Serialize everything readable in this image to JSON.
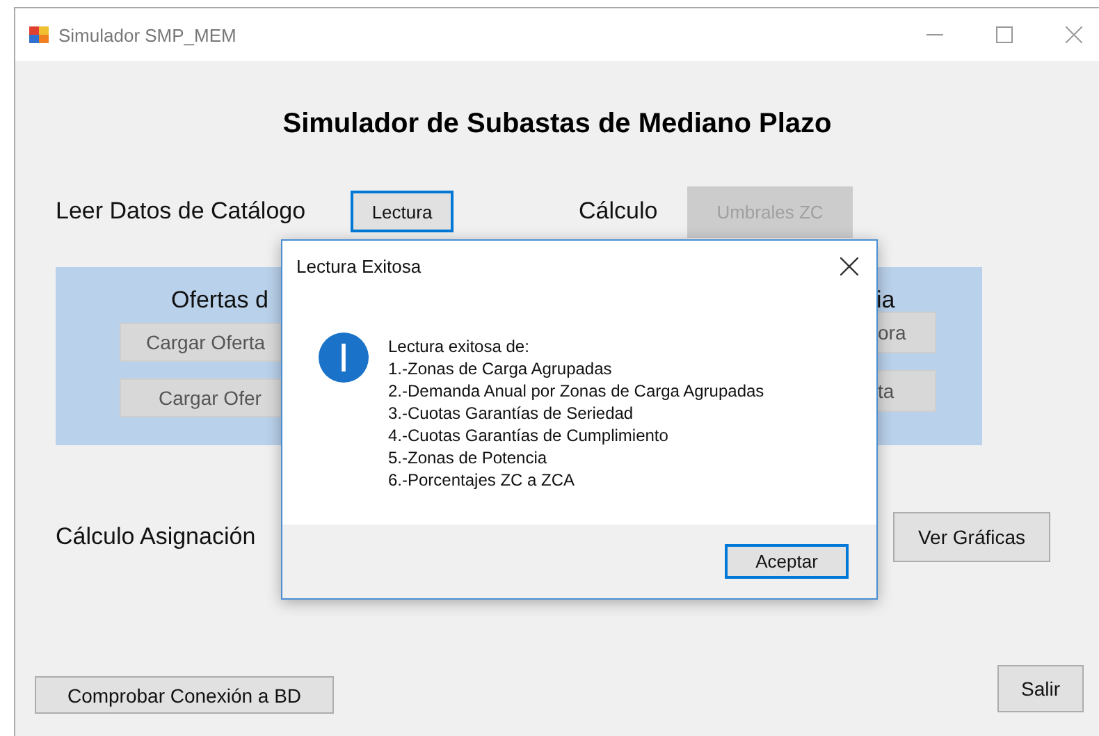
{
  "window": {
    "title": "Simulador SMP_MEM"
  },
  "heading": "Simulador de Subastas de Mediano Plazo",
  "catalog": {
    "label": "Leer Datos de Catálogo",
    "button": {
      "label": "Lectura",
      "focused": true,
      "disabled": false
    }
  },
  "calculation": {
    "label": "Cálculo",
    "button": {
      "label": "Umbrales ZC",
      "focused": false,
      "disabled": true
    }
  },
  "offers_panel": {
    "left_heading": "Ofertas d",
    "right_heading": "ia",
    "left_buttons": [
      {
        "label": "Cargar Oferta"
      },
      {
        "label": "Cargar Ofer"
      }
    ],
    "right_buttons": [
      {
        "label": "ora"
      },
      {
        "label": "ta"
      }
    ]
  },
  "assignment": {
    "label": "Cálculo Asignación",
    "button": {
      "label": "Ver Gráficas",
      "focused": false,
      "disabled": false
    }
  },
  "footer_buttons": [
    {
      "label": "Comprobar Conexión a BD"
    },
    {
      "label": "Salir"
    }
  ],
  "dialog": {
    "title": "Lectura Exitosa",
    "message": "Lectura exitosa de:",
    "items": [
      "1.-Zonas de Carga Agrupadas",
      "2.-Demanda Anual por Zonas de Carga Agrupadas",
      "3.-Cuotas Garantías de Seriedad",
      "4.-Cuotas Garantías de Cumplimiento",
      "5.-Zonas de Potencia",
      "6.-Porcentajes ZC a ZCA"
    ],
    "button": {
      "label": "Aceptar",
      "focused": true,
      "disabled": false
    }
  }
}
